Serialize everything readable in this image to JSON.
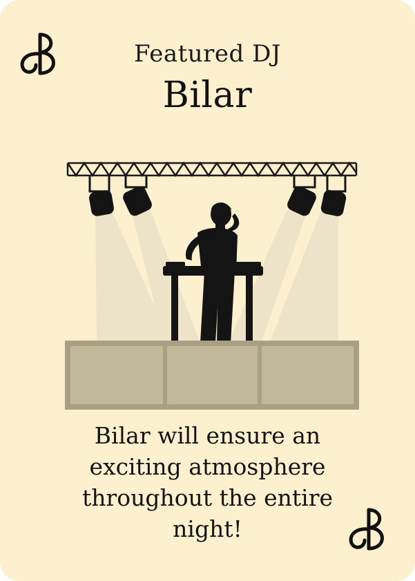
{
  "card": {
    "subtitle": "Featured DJ",
    "title": "Bilar",
    "description": "Bilar will ensure an exciting atmosphere throughout the entire night!"
  },
  "logo": {
    "glyph": "B",
    "icon": "monogram-b-icon"
  },
  "scene": {
    "icon": "dj-stage-illustration"
  },
  "colors": {
    "background": "#fdf0cf",
    "stage": "#c2b89a",
    "stage_border": "#a9a083",
    "silhouette": "#141414",
    "light_beam": "#ece3c8"
  }
}
